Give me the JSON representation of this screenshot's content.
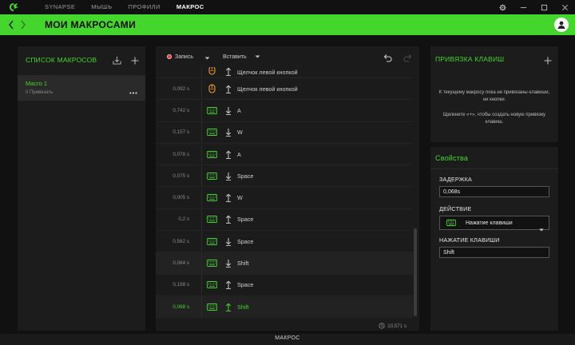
{
  "topnav": {
    "items": [
      "SYNAPSE",
      "МЫШЬ",
      "ПРОФИЛИ",
      "МАКРОС"
    ],
    "active_index": 3
  },
  "header": {
    "title": "МОИ МАКРОСАМИ"
  },
  "left_panel": {
    "title": "СПИСОК МАКРОСОВ",
    "macro": {
      "name": "Macro 1",
      "bindings": "0 Привязать"
    }
  },
  "toolbar": {
    "record_label": "Запись",
    "insert_label": "Вставить"
  },
  "events": [
    {
      "delay": "",
      "device": "mouse",
      "direction": "up",
      "label": "Щелчок левой кнопкой",
      "partial": true
    },
    {
      "delay": "0,092 s",
      "device": "mouse",
      "direction": "up",
      "label": "Щелчок левой кнопкой"
    },
    {
      "delay": "0,742 s",
      "device": "keyboard",
      "direction": "down",
      "label": "A"
    },
    {
      "delay": "0,157 s",
      "device": "keyboard",
      "direction": "down",
      "label": "W"
    },
    {
      "delay": "0,078 s",
      "device": "keyboard",
      "direction": "up",
      "label": "A"
    },
    {
      "delay": "0,075 s",
      "device": "keyboard",
      "direction": "down",
      "label": "Space"
    },
    {
      "delay": "0,005 s",
      "device": "keyboard",
      "direction": "up",
      "label": "W"
    },
    {
      "delay": "0,2 s",
      "device": "keyboard",
      "direction": "up",
      "label": "Space"
    },
    {
      "delay": "0,562 s",
      "device": "keyboard",
      "direction": "down",
      "label": "Space"
    },
    {
      "delay": "0,064 s",
      "device": "keyboard",
      "direction": "down",
      "label": "Shift",
      "shade": true
    },
    {
      "delay": "0,188 s",
      "device": "keyboard",
      "direction": "up",
      "label": "Space"
    },
    {
      "delay": "0,068 s",
      "device": "keyboard",
      "direction": "up",
      "label": "Shift",
      "selected": true,
      "shade": true
    }
  ],
  "total_time": "10,571 s",
  "key_binding_panel": {
    "title": "ПРИВЯЗКА КЛАВИШ",
    "message1": "К текущему макросу пока не привязаны клавиши, ни кнопки.",
    "message2": "Щелкните «+», чтобы создать новую привязку клавиш."
  },
  "properties_panel": {
    "title": "Свойства",
    "delay_label": "ЗАДЕРЖКА",
    "delay_value": "0,068s",
    "action_label": "ДЕЙСТВИЕ",
    "action_value": "Нажатие клавиши",
    "keypress_label": "НАЖАТИЕ КЛАВИШИ",
    "keypress_value": "Shift"
  },
  "footer": {
    "label": "МАКРОС"
  },
  "colors": {
    "accent": "#44d62c",
    "background": "#111111",
    "panel": "#1c1c1c",
    "record": "#e83b3b"
  }
}
